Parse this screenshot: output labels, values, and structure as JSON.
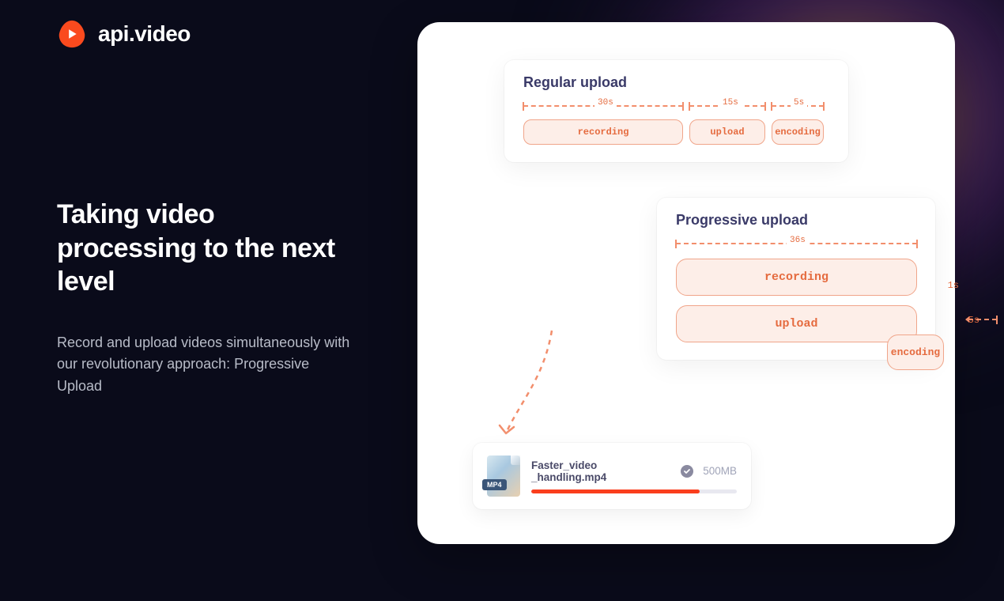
{
  "brand": {
    "name": "api.video"
  },
  "headline": "Taking video processing to the next level",
  "subcopy": "Record and upload videos simultaneously with our revolutionary approach: Progressive Upload",
  "regular": {
    "title": "Regular upload",
    "durations": {
      "recording": "30s",
      "upload": "15s",
      "encoding": "5s"
    },
    "steps": {
      "recording": "recording",
      "upload": "upload",
      "encoding": "encoding"
    }
  },
  "progressive": {
    "title": "Progressive upload",
    "total": "36s",
    "upload_offset": "1s",
    "encoding_offset": "5s",
    "steps": {
      "recording": "recording",
      "upload": "upload",
      "encoding": "encoding"
    }
  },
  "file": {
    "badge": "MP4",
    "name": "Faster_video _handling.mp4",
    "size": "500MB",
    "progress_pct": 82
  },
  "colors": {
    "accent": "#fa3e1d",
    "step_border": "#f0a58a",
    "step_bg": "#fdeee8",
    "step_text": "#e56b3f",
    "heading": "#3a3a68"
  }
}
